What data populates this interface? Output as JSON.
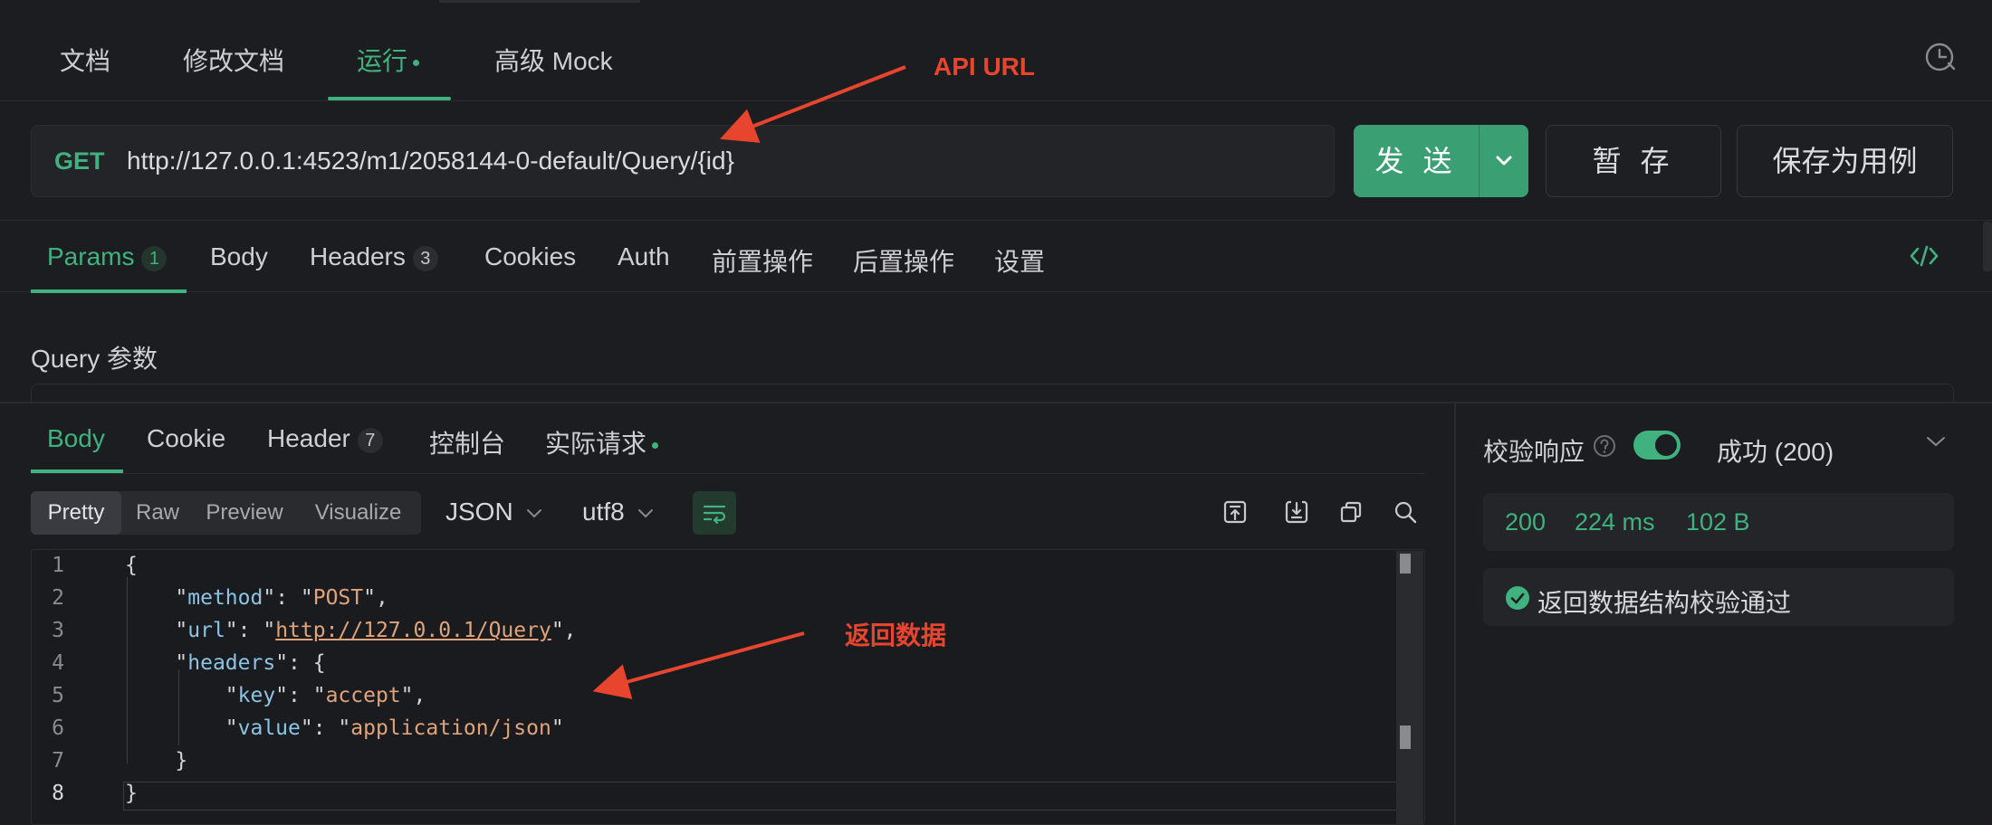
{
  "top_tabs": [
    {
      "label": "文档"
    },
    {
      "label": "修改文档"
    },
    {
      "label": "运行",
      "active": true
    },
    {
      "label": "高级 Mock"
    }
  ],
  "request": {
    "method": "GET",
    "url": "http://127.0.0.1:4523/m1/2058144-0-default/Query/{id}",
    "send_label": "发 送",
    "stash_label": "暂 存",
    "save_case_label": "保存为用例"
  },
  "request_tabs": [
    {
      "label": "Params",
      "badge": "1",
      "active": true
    },
    {
      "label": "Body"
    },
    {
      "label": "Headers",
      "badge": "3"
    },
    {
      "label": "Cookies"
    },
    {
      "label": "Auth"
    },
    {
      "label": "前置操作"
    },
    {
      "label": "后置操作"
    },
    {
      "label": "设置"
    }
  ],
  "query_section_label": "Query 参数",
  "response_tabs": [
    {
      "label": "Body",
      "active": true
    },
    {
      "label": "Cookie"
    },
    {
      "label": "Header",
      "badge": "7"
    },
    {
      "label": "控制台"
    },
    {
      "label": "实际请求"
    }
  ],
  "view_modes": [
    "Pretty",
    "Raw",
    "Preview",
    "Visualize"
  ],
  "format_select": "JSON",
  "encoding_select": "utf8",
  "code_lines": [
    "1",
    "2",
    "3",
    "4",
    "5",
    "6",
    "7",
    "8"
  ],
  "response_json": {
    "method_key": "method",
    "method_val": "POST",
    "url_key": "url",
    "url_val": "http://127.0.0.1/Query",
    "headers_key": "headers",
    "hkey_key": "key",
    "hkey_val": "accept",
    "hval_key": "value",
    "hval_val": "application/json"
  },
  "validation": {
    "label": "校验响应",
    "status_select": "成功 (200)",
    "status_code": "200",
    "time": "224 ms",
    "size": "102 B",
    "pass_text": "返回数据结构校验通过"
  },
  "annotations": {
    "api_url": "API URL",
    "return_data": "返回数据"
  },
  "colors": {
    "accent_green": "#3fb27f",
    "annotation_red": "#e8452f",
    "background": "#1c1d20"
  },
  "icons": [
    "history-icon",
    "code-icon",
    "help-icon",
    "chevron-down-icon",
    "wrap-lines-icon",
    "export-icon",
    "download-icon",
    "copy-icon",
    "search-icon",
    "check-circle-icon"
  ]
}
